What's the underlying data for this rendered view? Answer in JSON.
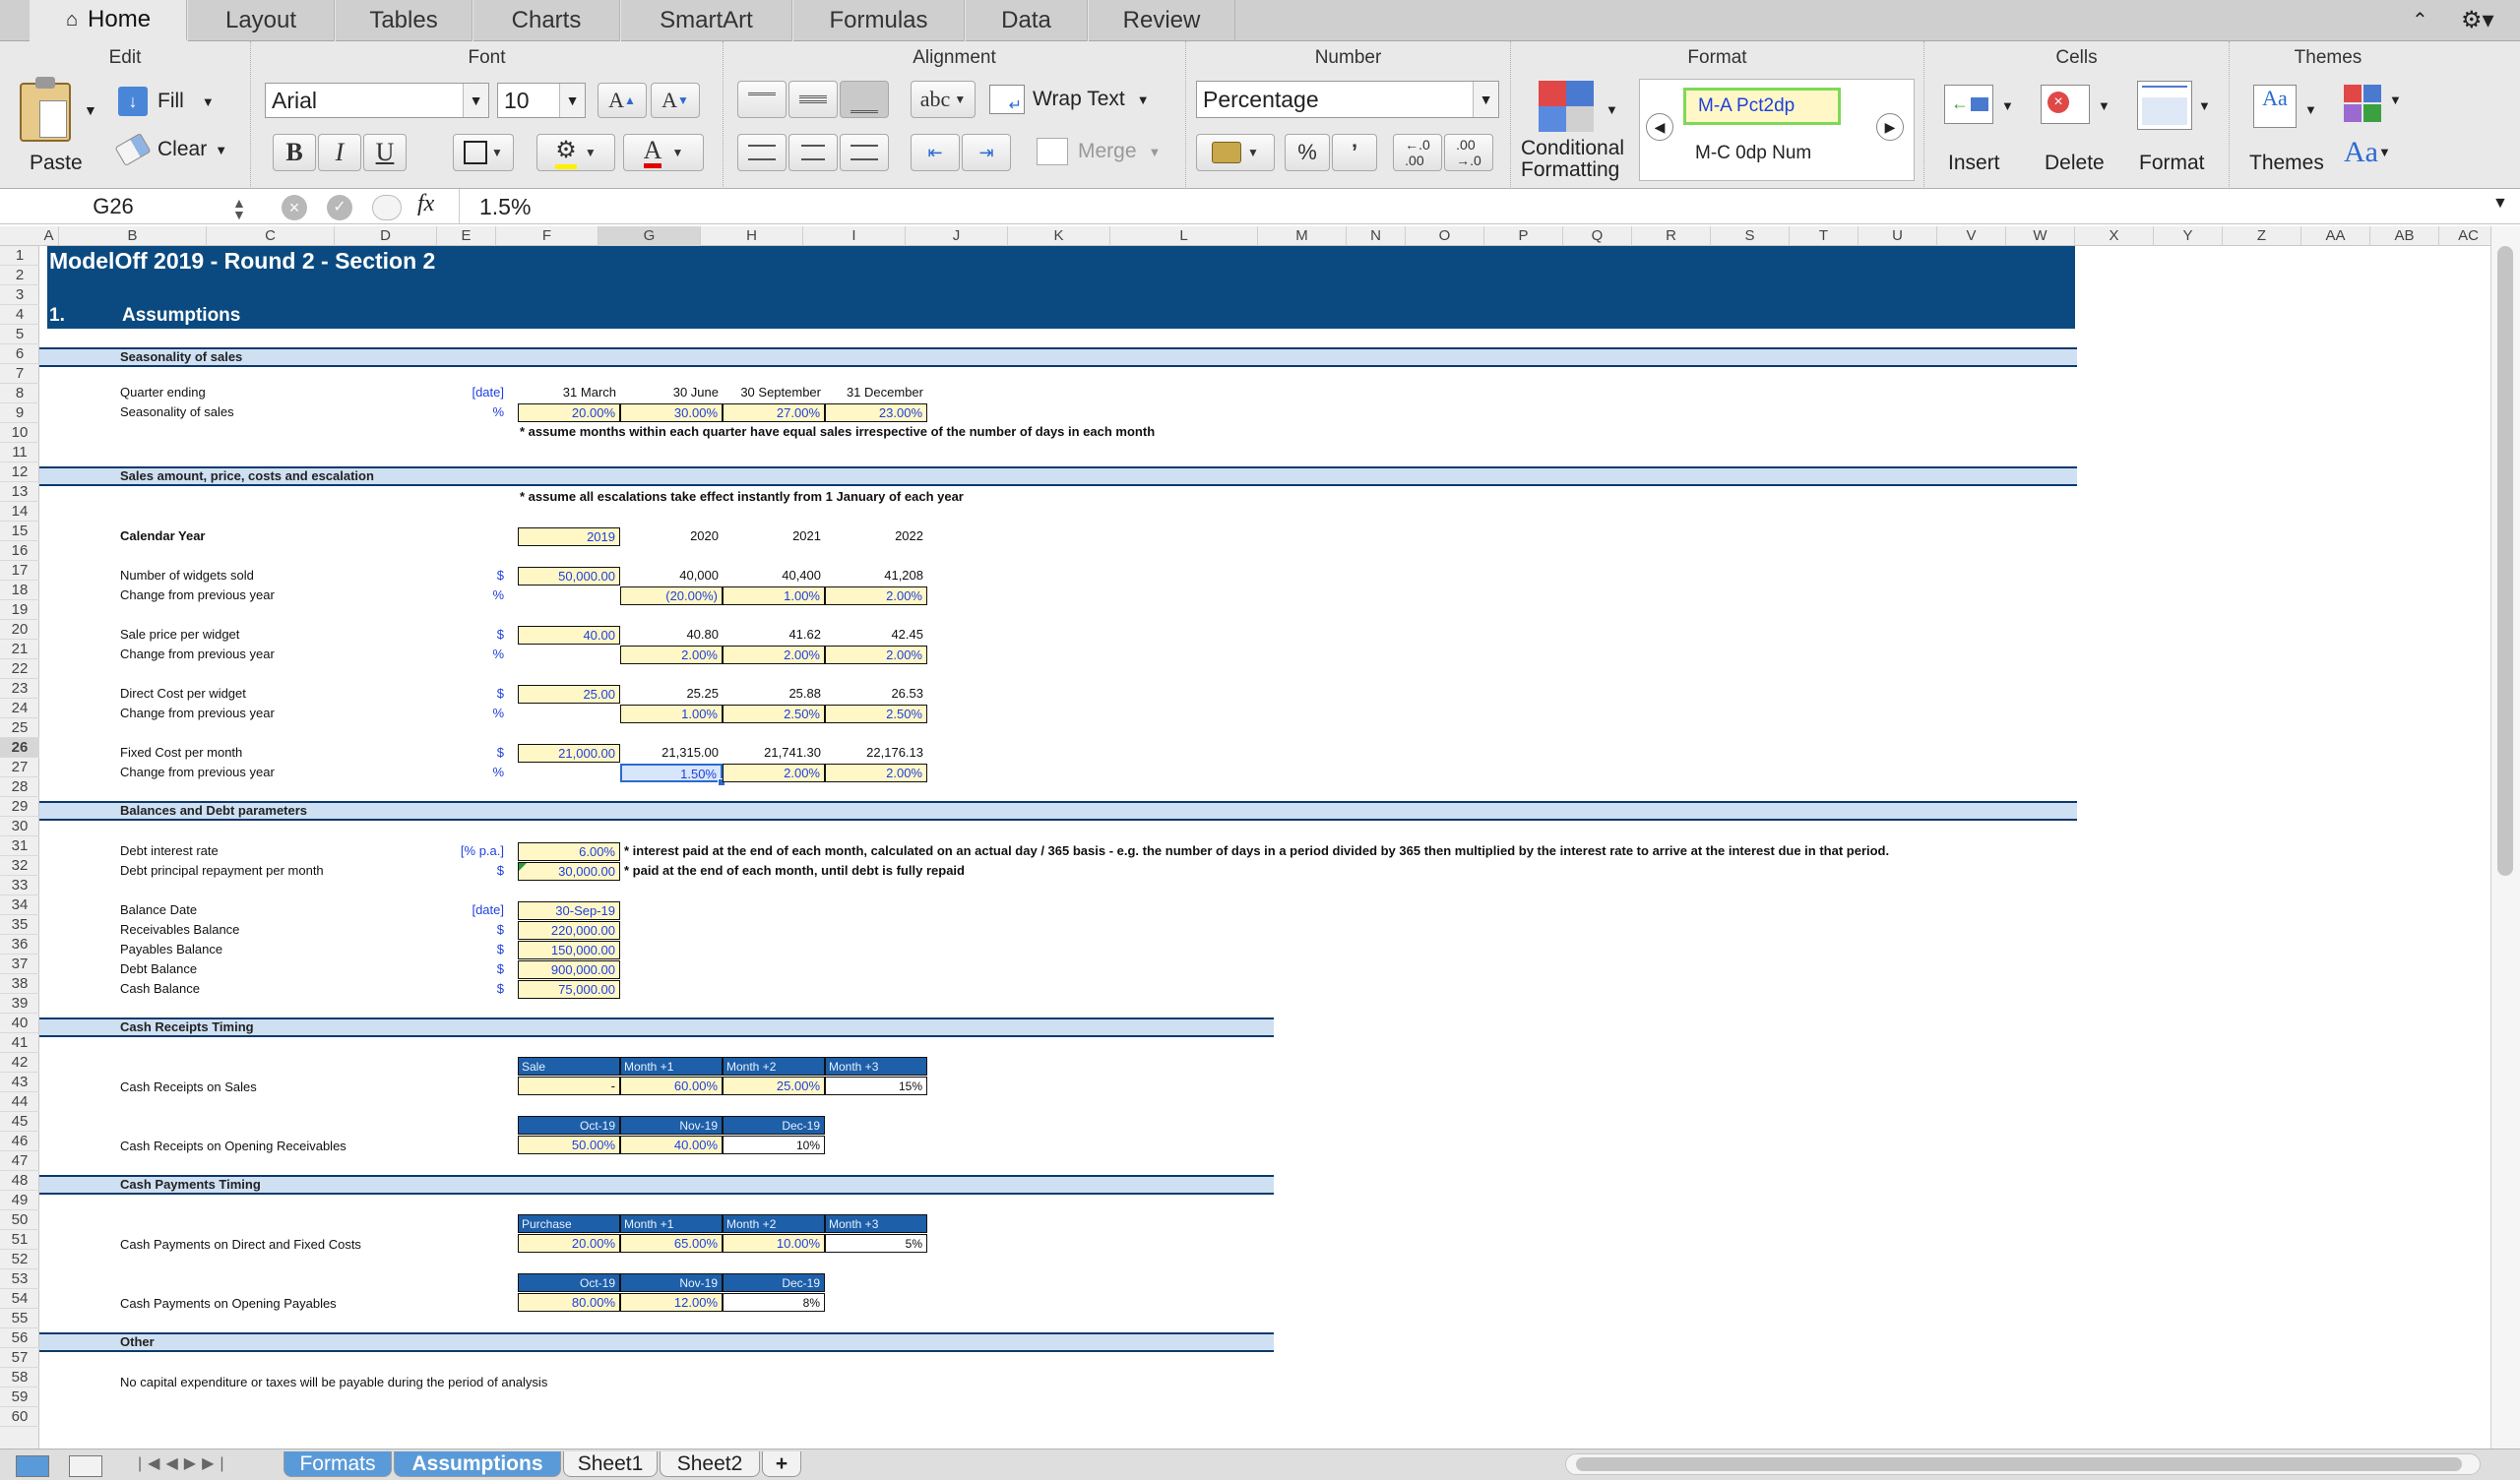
{
  "tabs": [
    {
      "label": "Home",
      "active": true
    },
    {
      "label": "Layout"
    },
    {
      "label": "Tables"
    },
    {
      "label": "Charts"
    },
    {
      "label": "SmartArt"
    },
    {
      "label": "Formulas"
    },
    {
      "label": "Data"
    },
    {
      "label": "Review"
    }
  ],
  "ribbon": {
    "groups": {
      "edit": "Edit",
      "font": "Font",
      "alignment": "Alignment",
      "number": "Number",
      "format": "Format",
      "cells": "Cells",
      "themes": "Themes"
    },
    "paste": "Paste",
    "fill": "Fill",
    "clear": "Clear",
    "font_name": "Arial",
    "font_size": "10",
    "bold": "B",
    "italic": "I",
    "underline": "U",
    "wrap_text": "Wrap Text",
    "merge": "Merge",
    "abc": "abc",
    "number_format": "Percentage",
    "pct": "%",
    "comma": "’",
    "cond_format_line1": "Conditional",
    "cond_format_line2": "Formatting",
    "style_1": "M-A Pct2dp",
    "style_2": "M-C 0dp Num",
    "insert": "Insert",
    "delete": "Delete",
    "format": "Format",
    "themes": "Themes",
    "aa": "Aa"
  },
  "formula_bar": {
    "cell_ref": "G26",
    "fx": "fx",
    "value": "1.5%"
  },
  "columns": [
    "A",
    "B",
    "C",
    "D",
    "E",
    "F",
    "G",
    "H",
    "I",
    "J",
    "K",
    "L",
    "M",
    "N",
    "O",
    "P",
    "Q",
    "R",
    "S",
    "T",
    "U",
    "V",
    "W",
    "X",
    "Y",
    "Z",
    "AA",
    "AB",
    "AC"
  ],
  "sheet": {
    "title": "ModelOff 2019 - Round 2 - Section 2",
    "section_num": "1.",
    "section_title": "Assumptions",
    "bands": {
      "seasonality": "Seasonality of sales",
      "sales": "Sales amount, price, costs and escalation",
      "balances": "Balances and Debt parameters",
      "cash_receipts": "Cash Receipts Timing",
      "cash_payments": "Cash Payments Timing",
      "other": "Other"
    },
    "r7": {
      "label": "Quarter ending",
      "unit": "[date]",
      "q1": "31 March",
      "q2": "30 June",
      "q3": "30 September",
      "q4": "31 December"
    },
    "r8": {
      "label": "Seasonality of sales",
      "unit": "%",
      "q1": "20.00%",
      "q2": "30.00%",
      "q3": "27.00%",
      "q4": "23.00%"
    },
    "note9": "* assume months within each quarter have equal sales irrespective of the number of days in each month",
    "note12": "* assume all escalations take effect instantly from 1 January of each year",
    "r14": {
      "label": "Calendar Year",
      "y1": "2019",
      "y2": "2020",
      "y3": "2021",
      "y4": "2022"
    },
    "r16": {
      "label": "Number of widgets sold",
      "unit": "$",
      "y1": "50,000.00",
      "y2": "40,000",
      "y3": "40,400",
      "y4": "41,208"
    },
    "r17": {
      "label": "Change from previous year",
      "unit": "%",
      "y2": "(20.00%)",
      "y3": "1.00%",
      "y4": "2.00%"
    },
    "r19": {
      "label": "Sale price per widget",
      "unit": "$",
      "y1": "40.00",
      "y2": "40.80",
      "y3": "41.62",
      "y4": "42.45"
    },
    "r20": {
      "label": "Change from previous year",
      "unit": "%",
      "y2": "2.00%",
      "y3": "2.00%",
      "y4": "2.00%"
    },
    "r22": {
      "label": "Direct Cost per widget",
      "unit": "$",
      "y1": "25.00",
      "y2": "25.25",
      "y3": "25.88",
      "y4": "26.53"
    },
    "r23": {
      "label": "Change from previous year",
      "unit": "%",
      "y2": "1.00%",
      "y3": "2.50%",
      "y4": "2.50%"
    },
    "r25": {
      "label": "Fixed Cost per month",
      "unit": "$",
      "y1": "21,000.00",
      "y2": "21,315.00",
      "y3": "21,741.30",
      "y4": "22,176.13"
    },
    "r26": {
      "label": "Change from previous year",
      "unit": "%",
      "y2": "1.50%",
      "y3": "2.00%",
      "y4": "2.00%"
    },
    "r30": {
      "label": "Debt interest rate",
      "unit": "[% p.a.]",
      "val": "6.00%",
      "note": "* interest paid at the end of each month, calculated on an actual day / 365 basis - e.g. the number of days in a period divided by 365 then multiplied by the interest rate to arrive at the interest due in that period."
    },
    "r31": {
      "label": "Debt principal repayment per month",
      "unit": "$",
      "val": "30,000.00",
      "note": "* paid at the end of each month, until debt is fully repaid"
    },
    "r33": {
      "label": "Balance Date",
      "unit": "[date]",
      "val": "30-Sep-19"
    },
    "r34": {
      "label": "Receivables Balance",
      "unit": "$",
      "val": "220,000.00"
    },
    "r35": {
      "label": "Payables Balance",
      "unit": "$",
      "val": "150,000.00"
    },
    "r36": {
      "label": "Debt Balance",
      "unit": "$",
      "val": "900,000.00"
    },
    "r37": {
      "label": "Cash Balance",
      "unit": "$",
      "val": "75,000.00"
    },
    "r41": {
      "h1": "Sale",
      "h2": "Month +1",
      "h3": "Month +2",
      "h4": "Month +3"
    },
    "r42": {
      "label": "Cash Receipts on Sales",
      "v1": "-",
      "v2": "60.00%",
      "v3": "25.00%",
      "v4": "15%"
    },
    "r44": {
      "h1": "Oct-19",
      "h2": "Nov-19",
      "h3": "Dec-19"
    },
    "r45": {
      "label": "Cash Receipts on Opening Receivables",
      "v1": "50.00%",
      "v2": "40.00%",
      "v3": "10%"
    },
    "r49": {
      "h1": "Purchase",
      "h2": "Month +1",
      "h3": "Month +2",
      "h4": "Month +3"
    },
    "r50": {
      "label": "Cash Payments on Direct and Fixed Costs",
      "v1": "20.00%",
      "v2": "65.00%",
      "v3": "10.00%",
      "v4": "5%"
    },
    "r52": {
      "h1": "Oct-19",
      "h2": "Nov-19",
      "h3": "Dec-19"
    },
    "r53": {
      "label": "Cash Payments on Opening Payables",
      "v1": "80.00%",
      "v2": "12.00%",
      "v3": "8%"
    },
    "r57": "No capital expenditure or taxes will be payable during the period of analysis"
  },
  "sheet_tabs": [
    "Formats",
    "Assumptions",
    "Sheet1",
    "Sheet2"
  ],
  "add_sheet": "+"
}
